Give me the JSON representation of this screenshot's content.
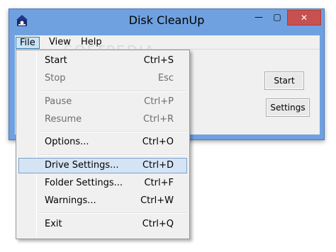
{
  "window": {
    "title": "Disk CleanUp",
    "controls": {
      "minimize": "—",
      "maximize": "▢",
      "close": "✕"
    }
  },
  "menubar": {
    "items": [
      {
        "label": "File"
      },
      {
        "label": "View"
      },
      {
        "label": "Help"
      }
    ]
  },
  "buttons": {
    "start": "Start",
    "settings": "Settings"
  },
  "file_menu": {
    "items": [
      {
        "label": "Start",
        "shortcut": "Ctrl+S",
        "enabled": true
      },
      {
        "label": "Stop",
        "shortcut": "Esc",
        "enabled": false
      },
      {
        "label": "Pause",
        "shortcut": "Ctrl+P",
        "enabled": false
      },
      {
        "label": "Resume",
        "shortcut": "Ctrl+R",
        "enabled": false
      },
      {
        "label": "Options...",
        "shortcut": "Ctrl+O",
        "enabled": true
      },
      {
        "label": "Drive Settings...",
        "shortcut": "Ctrl+D",
        "enabled": true,
        "highlighted": true
      },
      {
        "label": "Folder Settings...",
        "shortcut": "Ctrl+F",
        "enabled": true
      },
      {
        "label": "Warnings...",
        "shortcut": "Ctrl+W",
        "enabled": true
      },
      {
        "label": "Exit",
        "shortcut": "Ctrl+Q",
        "enabled": true
      }
    ]
  },
  "watermark": {
    "brand": "SOFTPEDIA",
    "url": "www.softpedia.com"
  },
  "colors": {
    "window_frame": "#6fa1e0",
    "close_button": "#c75050",
    "menu_highlight": "#d5e4f5",
    "menu_highlight_border": "#7da2ce",
    "disabled_text": "#6d6d6d"
  }
}
